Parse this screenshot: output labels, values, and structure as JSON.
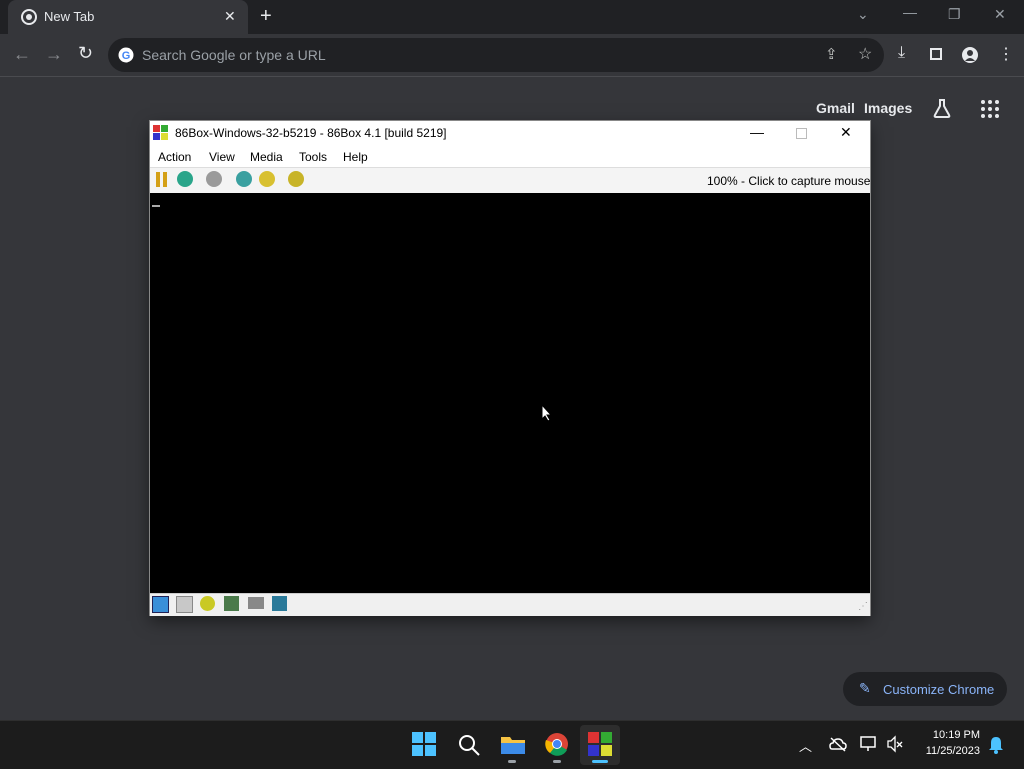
{
  "browser": {
    "tab_title": "New Tab",
    "omnibox_placeholder": "Search Google or type a URL",
    "gmail": "Gmail",
    "images": "Images",
    "customize": "Customize Chrome"
  },
  "vm_window": {
    "title": "86Box-Windows-32-b5219 - 86Box 4.1 [build 5219]",
    "menu": [
      "Action",
      "View",
      "Media",
      "Tools",
      "Help"
    ],
    "status": "100% - Click to capture mouse"
  },
  "taskbar": {
    "time": "10:19 PM",
    "date": "11/25/2023"
  },
  "colors": {
    "chrome_bg": "#35363a",
    "tabstrip_bg": "#202124",
    "accent": "#8ab4f8",
    "screen": "#000000",
    "taskbar": "#1c1c1c"
  }
}
